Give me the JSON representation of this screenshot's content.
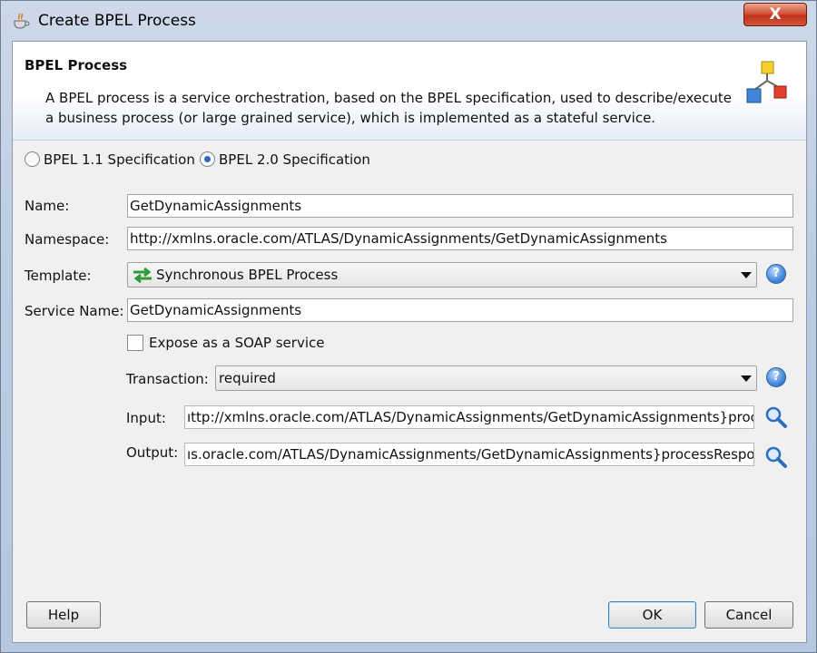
{
  "window": {
    "title": "Create BPEL Process",
    "close_label": "X"
  },
  "header": {
    "title": "BPEL Process",
    "description": "A BPEL process is a service orchestration, based on the BPEL specification, used to describe/execute a business process (or large grained service), which is implemented as a stateful service."
  },
  "spec": {
    "option_11": "BPEL 1.1 Specification",
    "option_20": "BPEL 2.0 Specification",
    "selected": "BPEL 2.0 Specification"
  },
  "form": {
    "name_label": "Name:",
    "name_value": "GetDynamicAssignments",
    "namespace_label": "Namespace:",
    "namespace_value": "http://xmlns.oracle.com/ATLAS/DynamicAssignments/GetDynamicAssignments",
    "template_label": "Template:",
    "template_value": "Synchronous BPEL Process",
    "service_name_label": "Service Name:",
    "service_name_value": "GetDynamicAssignments",
    "expose_soap_label": "Expose as a SOAP service",
    "expose_soap_checked": false,
    "transaction_label": "Transaction:",
    "transaction_value": "required",
    "input_label": "Input:",
    "input_value": "ıttp://xmlns.oracle.com/ATLAS/DynamicAssignments/GetDynamicAssignments}process",
    "output_label": "Output:",
    "output_value": "ıs.oracle.com/ATLAS/DynamicAssignments/GetDynamicAssignments}processResponse"
  },
  "buttons": {
    "help": "Help",
    "ok": "OK",
    "cancel": "Cancel"
  },
  "icons": {
    "title": "java-cup-icon",
    "header": "bpel-process-icon",
    "template": "sync-arrows-icon",
    "help": "help-icon",
    "search": "search-icon"
  }
}
